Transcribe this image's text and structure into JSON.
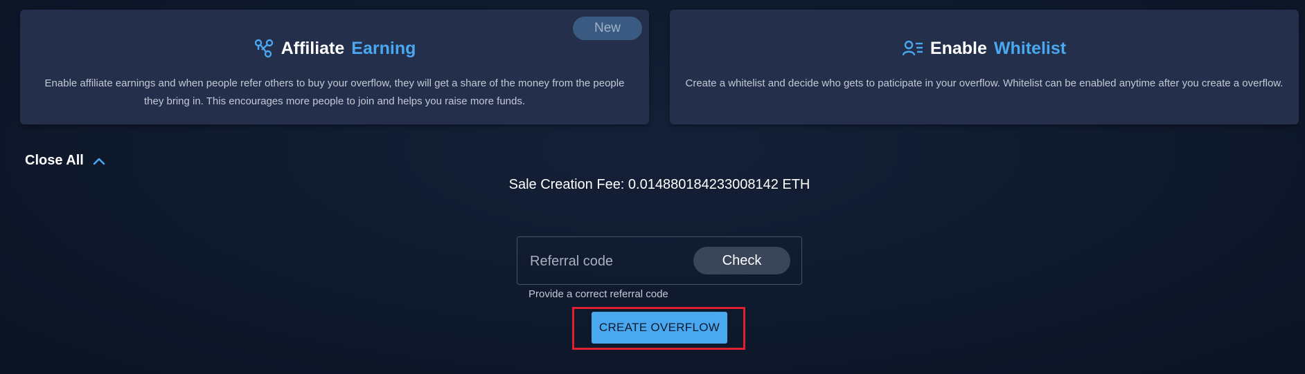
{
  "cards": {
    "affiliate": {
      "title_white": "Affiliate",
      "title_blue": "Earning",
      "badge": "New",
      "description": "Enable affiliate earnings and when people refer others to buy your overflow, they will get a share of the money from the people they bring in. This encourages more people to join and helps you raise more funds.",
      "icon": "share-nodes-icon"
    },
    "whitelist": {
      "title_white": "Enable",
      "title_blue": "Whitelist",
      "description": "Create a whitelist and decide who gets to paticipate in your overflow. Whitelist can be enabled anytime after you create a overflow.",
      "icon": "user-list-icon"
    }
  },
  "close_all": {
    "label": "Close All",
    "icon": "chevron-up-icon"
  },
  "fee": {
    "text": "Sale Creation Fee: 0.014880184233008142 ETH"
  },
  "referral": {
    "placeholder": "Referral code",
    "value": "",
    "check_label": "Check",
    "helper": "Provide a correct referral code"
  },
  "create_button": {
    "label": "CREATE OVERFLOW"
  },
  "colors": {
    "accent": "#4aa8f0",
    "card_bg": "#242f4b",
    "page_bg": "#0f1a2e",
    "highlight": "#e0202e"
  }
}
